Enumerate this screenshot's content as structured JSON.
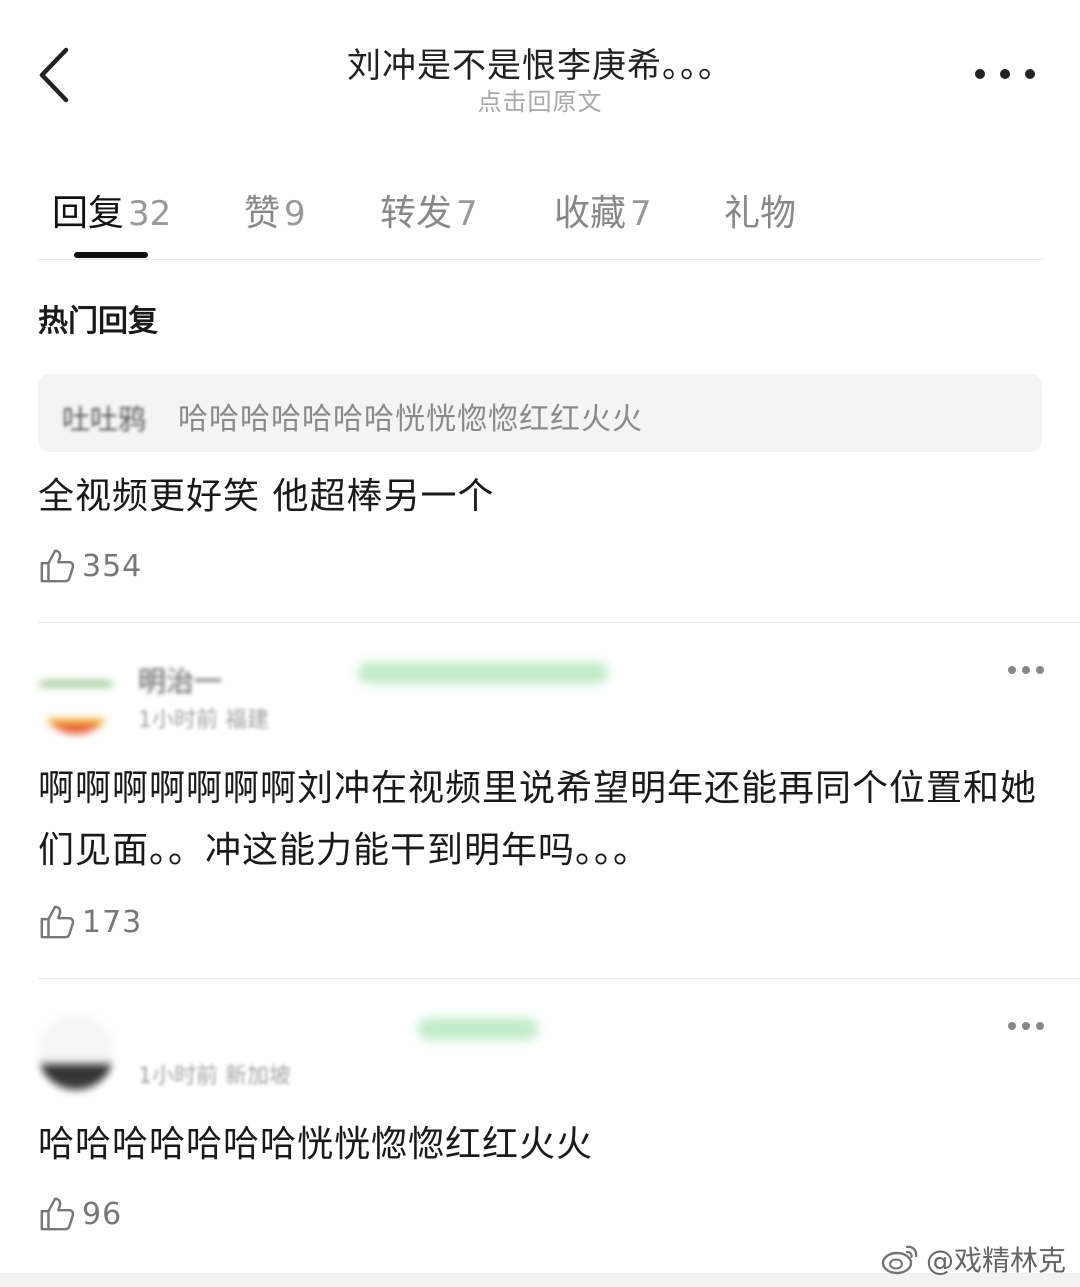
{
  "header": {
    "title": "刘冲是不是恨李庚希。。。",
    "subtitle": "点击回原文"
  },
  "tabs": [
    {
      "label": "回复",
      "count": "32",
      "active": true
    },
    {
      "label": "赞",
      "count": "9",
      "active": false
    },
    {
      "label": "转发",
      "count": "7",
      "active": false
    },
    {
      "label": "收藏",
      "count": "7",
      "active": false
    },
    {
      "label": "礼物",
      "count": "",
      "active": false
    }
  ],
  "section_title": "热门回复",
  "comments": [
    {
      "quote_user": "吐吐鸦",
      "quote_text": "哈哈哈哈哈哈哈恍恍惚惚红红火火",
      "text": "全视频更好笑 他超棒另一个",
      "likes": "354"
    },
    {
      "author": "明治一",
      "meta": "1小时前 福建",
      "text": "啊啊啊啊啊啊啊刘冲在视频里说希望明年还能再同个位置和她们见面。。冲这能力能干到明年吗。。。",
      "likes": "173"
    },
    {
      "author": "",
      "meta": "1小时前 新加坡",
      "text": "哈哈哈哈哈哈哈恍恍惚惚红红火火",
      "likes": "96"
    }
  ],
  "watermark": "@戏精林克",
  "colors": {
    "text_primary": "#1a1a1a",
    "text_secondary": "#888888",
    "quote_bg": "#f4f4f4",
    "tab_indicator": "#111111"
  },
  "icons": {
    "back": "chevron-left-icon",
    "more": "more-horizontal-icon",
    "like": "thumbs-up-icon",
    "watermark": "weibo-logo-icon"
  }
}
